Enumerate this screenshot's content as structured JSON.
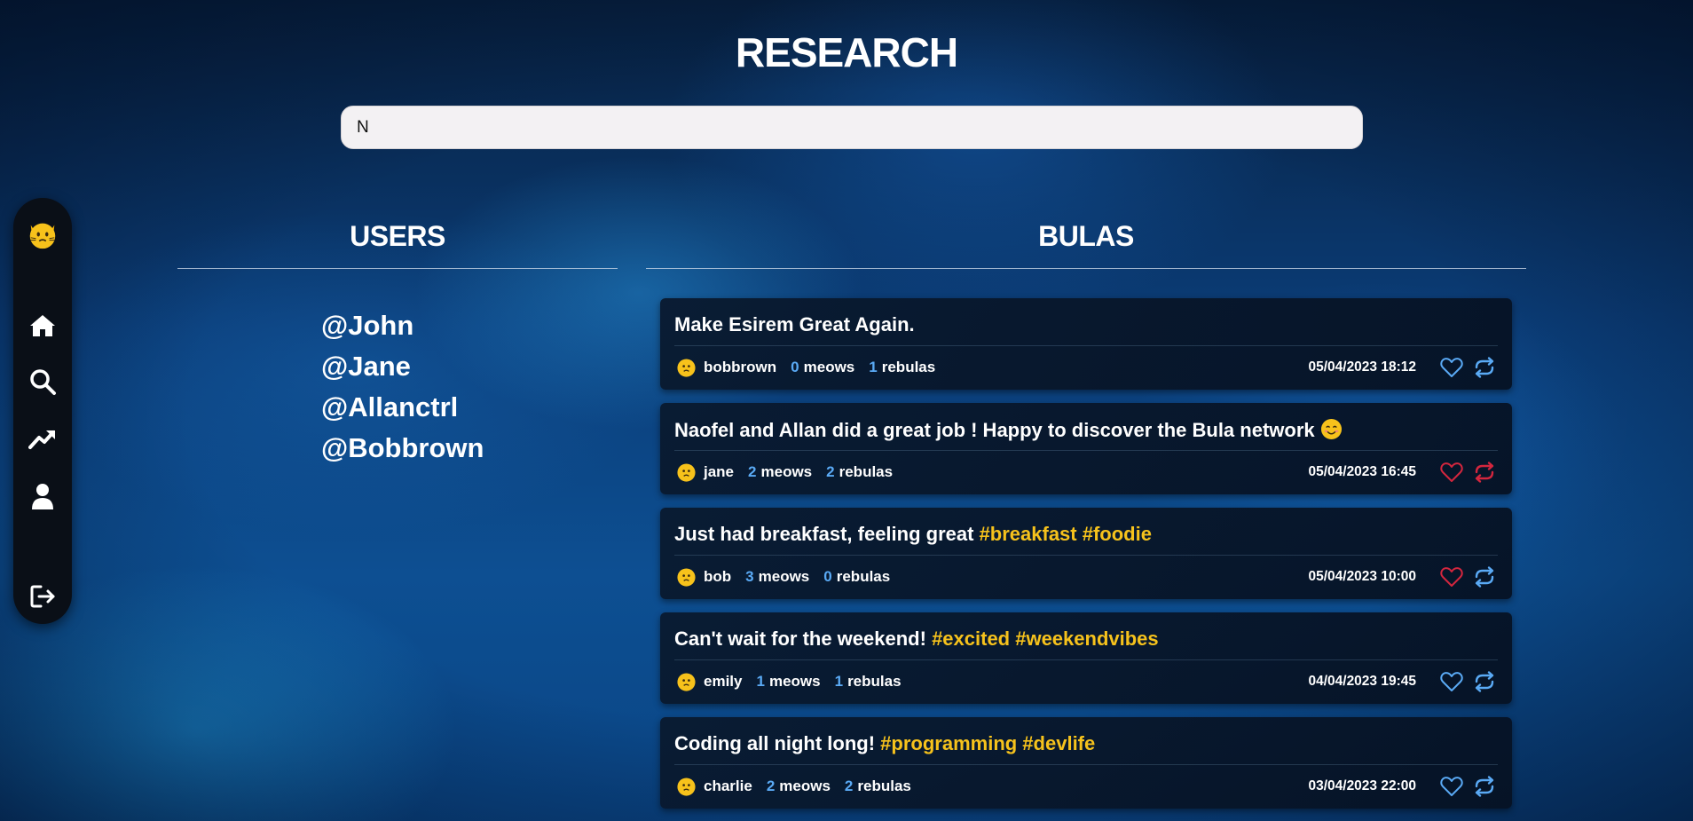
{
  "page": {
    "title": "RESEARCH"
  },
  "search": {
    "value": "N"
  },
  "sections": {
    "users_title": "USERS",
    "bulas_title": "BULAS"
  },
  "users": [
    "@John",
    "@Jane",
    "@Allanctrl",
    "@Bobbrown"
  ],
  "posts": [
    {
      "parts": [
        {
          "text": "Make Esirem Great Again.",
          "tag": false
        }
      ],
      "emoji": false,
      "author": "bobbrown",
      "meows": "0",
      "meows_label": "meows",
      "rebulas": "1",
      "rebulas_label": "rebulas",
      "date": "05/04/2023 18:12",
      "liked": false,
      "rebulaed": false
    },
    {
      "parts": [
        {
          "text": "Naofel and Allan did a great job ! Happy to discover the Bula network",
          "tag": false
        }
      ],
      "emoji": true,
      "author": "jane",
      "meows": "2",
      "meows_label": "meows",
      "rebulas": "2",
      "rebulas_label": "rebulas",
      "date": "05/04/2023 16:45",
      "liked": true,
      "rebulaed": true
    },
    {
      "parts": [
        {
          "text": "Just had breakfast, feeling great ",
          "tag": false
        },
        {
          "text": "#breakfast #foodie",
          "tag": true
        }
      ],
      "emoji": false,
      "author": "bob",
      "meows": "3",
      "meows_label": "meows",
      "rebulas": "0",
      "rebulas_label": "rebulas",
      "date": "05/04/2023 10:00",
      "liked": true,
      "rebulaed": false
    },
    {
      "parts": [
        {
          "text": "Can't wait for the weekend! ",
          "tag": false
        },
        {
          "text": "#excited #weekendvibes",
          "tag": true
        }
      ],
      "emoji": false,
      "author": "emily",
      "meows": "1",
      "meows_label": "meows",
      "rebulas": "1",
      "rebulas_label": "rebulas",
      "date": "04/04/2023 19:45",
      "liked": false,
      "rebulaed": false
    },
    {
      "parts": [
        {
          "text": "Coding all night long! ",
          "tag": false
        },
        {
          "text": "#programming #devlife",
          "tag": true
        }
      ],
      "emoji": false,
      "author": "charlie",
      "meows": "2",
      "meows_label": "meows",
      "rebulas": "2",
      "rebulas_label": "rebulas",
      "date": "03/04/2023 22:00",
      "liked": false,
      "rebulaed": false
    }
  ],
  "colors": {
    "accent": "#5aaaf5",
    "hashtag": "#f6c21c",
    "liked": "#d3263e",
    "sidebar": "#0a0f17"
  },
  "icons": {
    "sidebar": [
      "cat-avatar-icon",
      "home-icon",
      "search-icon",
      "trending-icon",
      "user-icon",
      "logout-icon"
    ],
    "post_actions": [
      "heart-icon",
      "repost-icon"
    ]
  }
}
